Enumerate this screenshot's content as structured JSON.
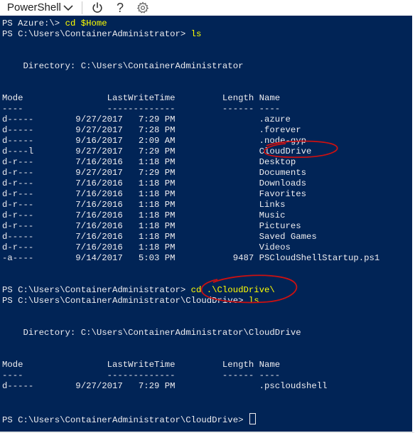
{
  "toolbar": {
    "shell_label": "PowerShell",
    "icons": [
      "chevron-down-icon",
      "power-icon",
      "help-icon",
      "gear-icon"
    ],
    "help_glyph": "?"
  },
  "terminal": {
    "background": "#012456",
    "text_color": "#eeedf0",
    "command_color": "#ffff00",
    "annotation_color": "#cc1111",
    "l01": {
      "prompt": "PS Azure:\\> ",
      "cmd": "cd $Home"
    },
    "l02": {
      "prompt": "PS C:\\Users\\ContainerAdministrator> ",
      "cmd": "ls"
    },
    "l03": "    Directory: C:\\Users\\ContainerAdministrator",
    "l04": "Mode                LastWriteTime         Length Name",
    "l05": "----                -------------         ------ ----",
    "l06": "d-----        9/27/2017   7:29 PM                .azure",
    "l07": "d-----        9/27/2017   7:28 PM                .forever",
    "l08": "d-----        9/16/2017   2:09 AM                .node-gyp",
    "l09": "d----l        9/27/2017   7:29 PM                CloudDrive",
    "l10": "d-r---        7/16/2016   1:18 PM                Desktop",
    "l11": "d-r---        9/27/2017   7:29 PM                Documents",
    "l12": "d-r---        7/16/2016   1:18 PM                Downloads",
    "l13": "d-r---        7/16/2016   1:18 PM                Favorites",
    "l14": "d-r---        7/16/2016   1:18 PM                Links",
    "l15": "d-r---        7/16/2016   1:18 PM                Music",
    "l16": "d-r---        7/16/2016   1:18 PM                Pictures",
    "l17": "d-----        7/16/2016   1:18 PM                Saved Games",
    "l18": "d-r---        7/16/2016   1:18 PM                Videos",
    "l19": "-a----        9/14/2017   5:03 PM           9487 PSCloudShellStartup.ps1",
    "l20": {
      "prompt": "PS C:\\Users\\ContainerAdministrator> ",
      "cmd": "cd .\\CloudDrive\\"
    },
    "l21": {
      "prompt": "PS C:\\Users\\ContainerAdministrator\\CloudDrive> ",
      "cmd": "ls"
    },
    "l22": "    Directory: C:\\Users\\ContainerAdministrator\\CloudDrive",
    "l23": "Mode                LastWriteTime         Length Name",
    "l24": "----                -------------         ------ ----",
    "l25": "d-----        9/27/2017   7:29 PM                .pscloudshell",
    "l26": {
      "prompt": "PS C:\\Users\\ContainerAdministrator\\CloudDrive> "
    }
  }
}
